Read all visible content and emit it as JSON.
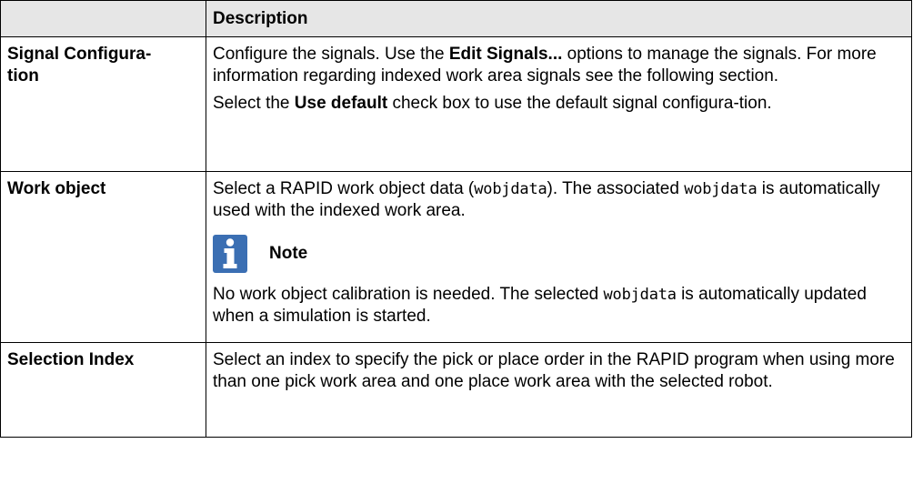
{
  "table": {
    "header": {
      "col1": "",
      "col2": "Description"
    },
    "rows": [
      {
        "term_line1": "Signal Configura-",
        "term_line2": "tion",
        "p1": {
          "t1": "Configure the signals. Use the ",
          "b1": "Edit Signals...",
          "t2": " options to manage the signals. For more information regarding indexed work area signals see the following section."
        },
        "p2": {
          "t1": "Select the ",
          "b1": "Use default",
          "t2": " check box to use the default signal configura-tion."
        }
      },
      {
        "term": "Work object",
        "p1": {
          "t1": "Select a RAPID work object data (",
          "code1": "wobjdata",
          "t2": "). The associated ",
          "code2": "wobjdata",
          "t3": " is automatically used with the indexed work area."
        },
        "note": {
          "icon": "info-icon",
          "label": "Note",
          "color": "#3b6fb3"
        },
        "p2": {
          "t1": "No work object calibration is needed. The selected ",
          "code1": "wobjdata",
          "t2": " is automatically updated when a simulation is started."
        }
      },
      {
        "term": "Selection Index",
        "p1": "Select an index to specify the pick or place order in the RAPID program when using more than one pick work area and one place work area with the selected robot."
      }
    ]
  }
}
